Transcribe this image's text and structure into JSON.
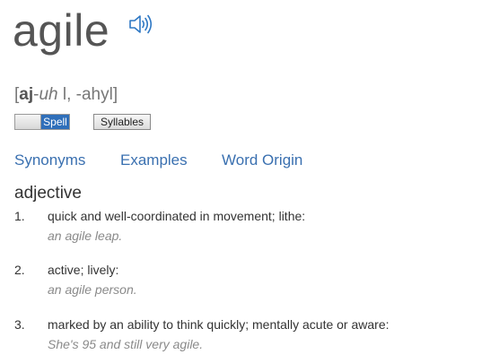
{
  "entry": {
    "headword": "agile",
    "audio_icon": "speaker-icon",
    "pronunciation": {
      "open_bracket": "[",
      "stressed": "aj",
      "hyphen": "-",
      "unstressed": "uh",
      "rest": " l, -ahyl",
      "close_bracket": "]"
    }
  },
  "controls": {
    "spell_toggle_label": "Spell",
    "syllables_button_label": "Syllables"
  },
  "links": {
    "synonyms": "Synonyms",
    "examples": "Examples",
    "word_origin": "Word Origin"
  },
  "definitions": {
    "part_of_speech": "adjective",
    "senses": [
      {
        "number": "1.",
        "definition": "quick and well-coordinated in movement; lithe:",
        "example": "an agile leap."
      },
      {
        "number": "2.",
        "definition": "active; lively:",
        "example": "an agile person."
      },
      {
        "number": "3.",
        "definition": "marked by an ability to think quickly; mentally acute or aware:",
        "example": "She's 95 and still very agile."
      }
    ]
  },
  "colors": {
    "link": "#3a70b0",
    "toggle_active": "#2f6fba",
    "audio_icon": "#2f78c4",
    "example_text": "#8a8a8a"
  }
}
